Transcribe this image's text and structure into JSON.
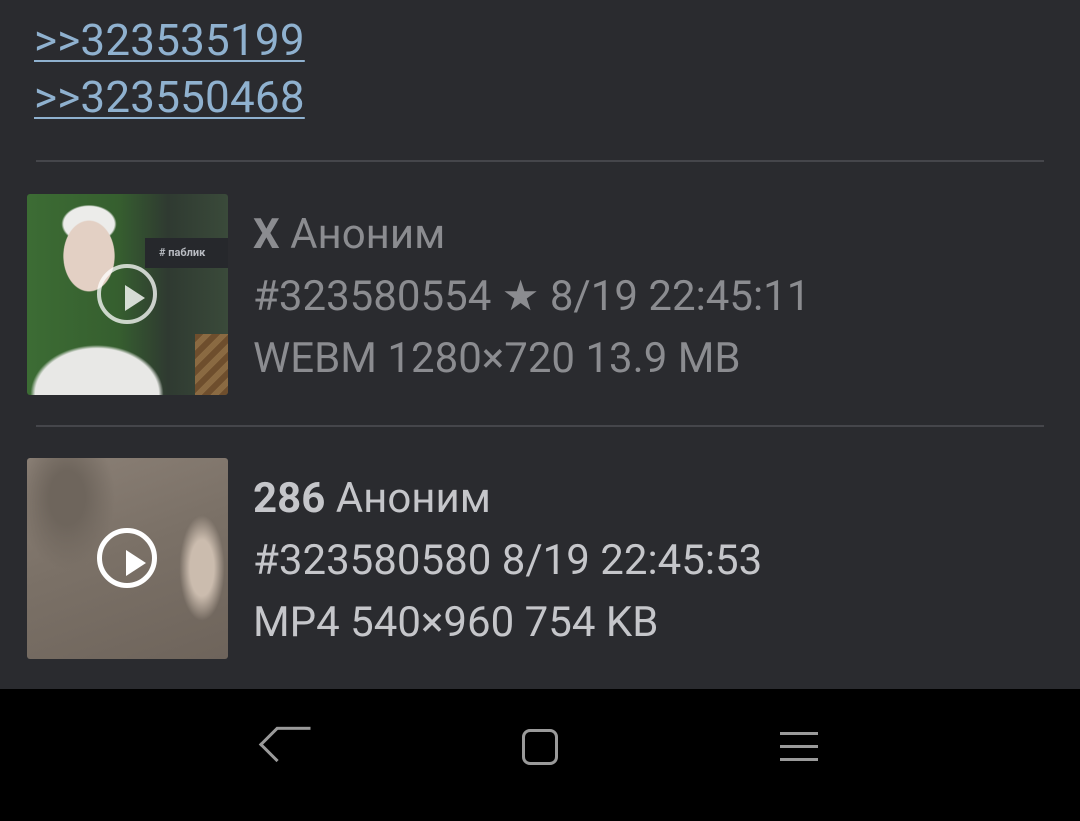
{
  "reply_links": [
    ">>323535199",
    ">>323550468"
  ],
  "posts": [
    {
      "thumbnail_label": "# паблик",
      "number": "X",
      "author": "Аноним",
      "post_id": "#323580554",
      "star_icon": "star-icon",
      "datetime": "8/19 22:45:11",
      "file_info": "WEBM 1280×720 13.9 MB"
    },
    {
      "number": "286",
      "author": "Аноним",
      "post_id": "#323580580",
      "datetime": "8/19 22:45:53",
      "file_info": "MP4 540×960 754 KB"
    }
  ],
  "navbar": {
    "icons": [
      "back-icon",
      "home-icon",
      "menu-icon"
    ]
  },
  "colors": {
    "background": "#2a2b2f",
    "link": "#8fb1cf",
    "muted_text": "#8b8c90",
    "bright_text": "#c5c6ca",
    "navbar": "#000000"
  }
}
